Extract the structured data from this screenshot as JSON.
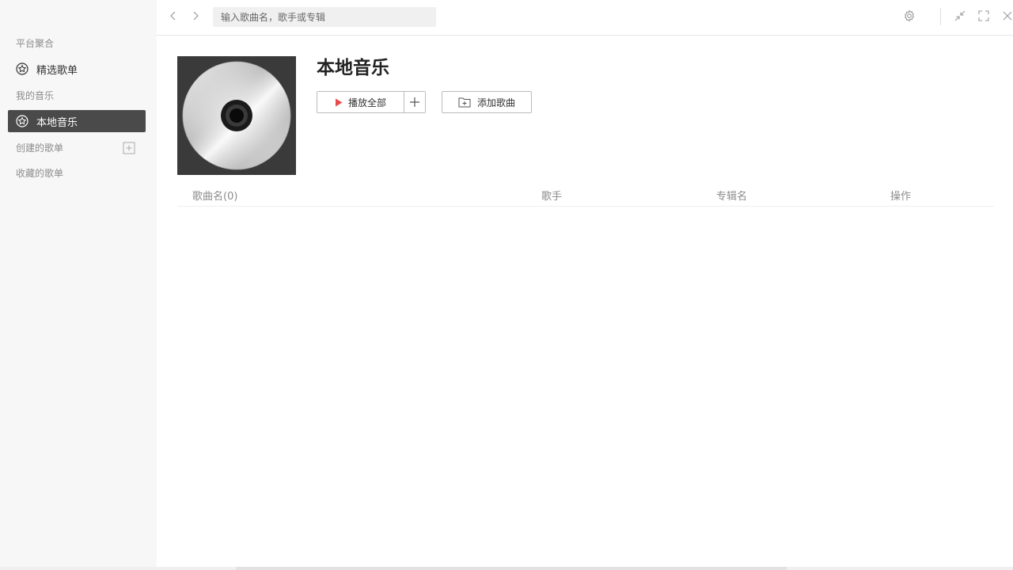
{
  "sidebar": {
    "section_platform": "平台聚合",
    "item_featured": "精选歌单",
    "section_my_music": "我的音乐",
    "item_local": "本地音乐",
    "section_created": "创建的歌单",
    "section_collected": "收藏的歌单"
  },
  "topbar": {
    "search_placeholder": "输入歌曲名，歌手或专辑"
  },
  "main": {
    "title": "本地音乐",
    "play_all_label": "播放全部",
    "add_songs_label": "添加歌曲",
    "table_headers": [
      "歌曲名(0)",
      "歌手",
      "专辑名",
      "操作"
    ]
  },
  "colors": {
    "accent_play": "#e84a4a",
    "sidebar_active_bg": "#4a4a4a"
  },
  "icons": {
    "featured": "star-badge-icon",
    "local": "star-badge-icon",
    "back": "chevron-left-icon",
    "forward": "chevron-right-icon",
    "settings": "gear-icon",
    "minimize": "minimize-icon",
    "maximize": "fullscreen-icon",
    "close": "close-icon",
    "add_playlist": "plus-square-icon",
    "play": "play-triangle-icon",
    "plus": "plus-icon",
    "folder_add": "folder-add-icon"
  }
}
